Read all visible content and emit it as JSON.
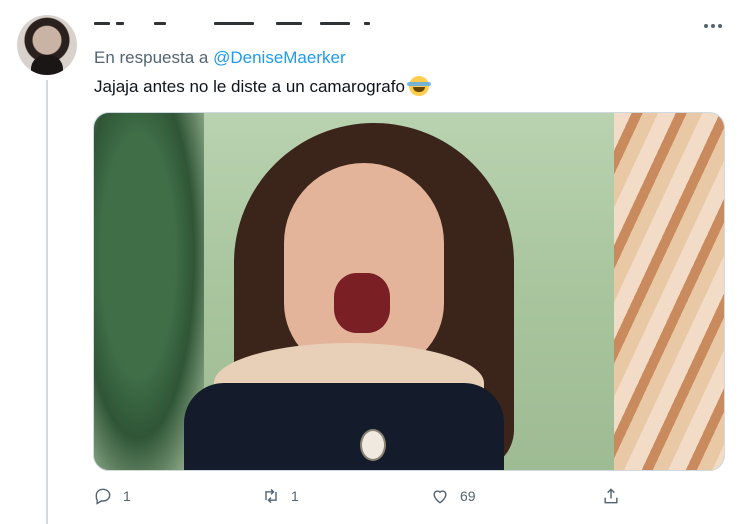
{
  "tweet": {
    "reply_prefix": "En respuesta a",
    "reply_to": "@DeniseMaerker",
    "text": "Jajaja antes no le diste a un camarografo",
    "emoji": "face-with-tears-of-joy"
  },
  "actions": {
    "reply_count": "1",
    "retweet_count": "1",
    "like_count": "69"
  },
  "colors": {
    "link": "#1d9bf0",
    "secondary_text": "#536471",
    "primary_text": "#0f1419"
  },
  "icons": [
    "more-icon",
    "reply-icon",
    "retweet-icon",
    "like-icon",
    "share-icon"
  ]
}
